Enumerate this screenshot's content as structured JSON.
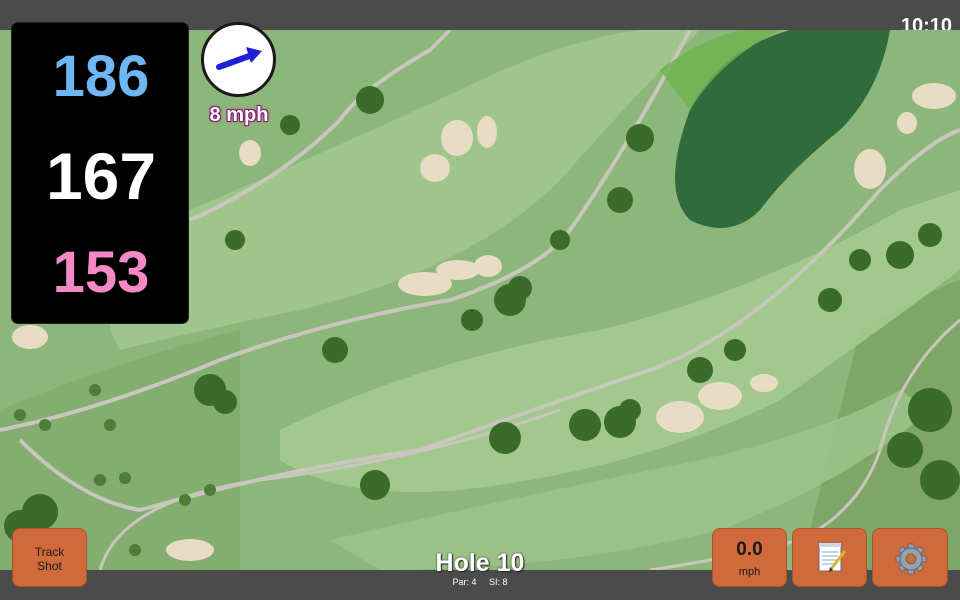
{
  "status": {
    "clock": "10:10"
  },
  "distances": {
    "back": "186",
    "middle": "167",
    "front": "153"
  },
  "wind": {
    "speed": "8 mph",
    "direction_icon": "arrow-icon",
    "arrow_color": "#1f1fd6"
  },
  "buttons": {
    "track_shot_line1": "Track",
    "track_shot_line2": "Shot",
    "speed_value": "0.0",
    "speed_unit": "mph",
    "notes_icon": "notepad-icon",
    "settings_icon": "gear-icon"
  },
  "hole": {
    "title": "Hole 10",
    "par": "Par: 4",
    "si": "SI: 8"
  },
  "colors": {
    "distance_back": "#6fb6f5",
    "distance_middle": "#ffffff",
    "distance_front": "#f489c6",
    "button": "#d06a3a",
    "bar": "#4b4b4b",
    "fairway": "#9fc58a",
    "rough": "#86ad6e",
    "water": "#2f6b3d",
    "bunker": "#e8dcc4"
  }
}
